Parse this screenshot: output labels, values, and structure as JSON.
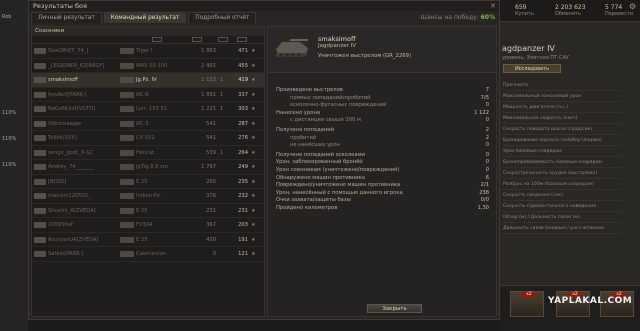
{
  "window": {
    "title": "Результаты боя"
  },
  "tabs": [
    {
      "label": "Личный результат"
    },
    {
      "label": "Командный результат"
    },
    {
      "label": "Подробный отчёт"
    }
  ],
  "win_chance": {
    "label": "Шансы на победу:",
    "value": "60%"
  },
  "allies": {
    "title": "Союзники",
    "rows": [
      {
        "player": "Sow28tt[T_74_]",
        "tank": "Tiger I",
        "xp": "1 863",
        "kills": "",
        "damage": "471",
        "dead": true
      },
      {
        "player": "_LEGIONER_62[BAGY]",
        "tank": "AMX 50 100",
        "xp": "2 401",
        "kills": "",
        "damage": "455",
        "dead": true
      },
      {
        "player": "smaksimoff",
        "tank": "Jg.Pz. IV",
        "xp": "1 122",
        "kills": "1",
        "damage": "419",
        "dead": false,
        "me": true
      },
      {
        "player": "fyrufert[PARK-]",
        "tank": "ИС-6",
        "xp": "1 891",
        "kills": "1",
        "damage": "337",
        "dead": true
      },
      {
        "player": "NaGaNUnit[VGTO]",
        "tank": "Lorr. 155 51",
        "xp": "1 215",
        "kills": "1",
        "damage": "303",
        "dead": true
      },
      {
        "player": "Vibromaager",
        "tank": "ИС-3",
        "xp": "541",
        "kills": "",
        "damage": "287",
        "dead": true
      },
      {
        "player": "Tolikk[SVX]",
        "tank": "СУ-152",
        "xp": "541",
        "kills": "",
        "damage": "276",
        "dead": true
      },
      {
        "player": "sengir_god[_X-G]",
        "tank": "Hellcat",
        "xp": "539",
        "kills": "1",
        "damage": "264",
        "dead": true
      },
      {
        "player": "Andrey_74_______",
        "tank": "JgTig.8,8 cm",
        "xp": "1 797",
        "kills": "",
        "damage": "249",
        "dead": true
      },
      {
        "player": "[BOSS]",
        "tank": "E 25",
        "xp": "265",
        "kills": "",
        "damage": "235",
        "dead": true
      },
      {
        "player": "maksim120502_",
        "tank": "Indien-Pz.",
        "xp": "376",
        "kills": "",
        "damage": "232",
        "dead": true
      },
      {
        "player": "Shustrij_A[ZVEDA]",
        "tank": "E 25",
        "xp": "231",
        "kills": "",
        "damage": "231",
        "dead": true
      },
      {
        "player": "2009Shef",
        "tank": "FV304",
        "xp": "367",
        "kills": "",
        "damage": "203",
        "dead": true
      },
      {
        "player": "AsuryanUA[ZVEDA]",
        "tank": "E 25",
        "xp": "420",
        "kills": "",
        "damage": "191",
        "dead": true
      },
      {
        "player": "Satkin[PARK-]",
        "tank": "Caernarvon",
        "xp": "0",
        "kills": "",
        "damage": "121",
        "dead": true
      }
    ]
  },
  "details": {
    "player": "smaksimoff",
    "tank": "Jagdpanzer IV",
    "killed_by": "Уничтожен выстрелом (GR_2269)",
    "stats": [
      {
        "label": "Произведено выстрелов",
        "value": "7",
        "sub": false
      },
      {
        "label": "прямых попаданий/пробитий",
        "value": "7/5",
        "sub": true
      },
      {
        "label": "осколочно-фугасных повреждений",
        "value": "0",
        "sub": true
      },
      {
        "label": "Нанесено урона",
        "value": "1 122",
        "sub": false
      },
      {
        "label": "с дистанции свыше 300 м",
        "value": "0",
        "sub": true
      },
      {
        "label": "Получено попаданий",
        "value": "2",
        "sub": false
      },
      {
        "label": "пробитий",
        "value": "2",
        "sub": true
      },
      {
        "label": "не нанёсших урон",
        "value": "0",
        "sub": true
      },
      {
        "label": "Получено попаданий осколками",
        "value": "0",
        "sub": false
      },
      {
        "label": "Урон, заблокированный бронёй",
        "value": "0",
        "sub": false
      },
      {
        "label": "Урон союзникам (уничтожено/повреждений)",
        "value": "0",
        "sub": false
      },
      {
        "label": "Обнаружено машин противника",
        "value": "6",
        "sub": false
      },
      {
        "label": "Повреждено/уничтожено машин противника",
        "value": "2/1",
        "sub": false
      },
      {
        "label": "Урон, нанесённый с помощью данного игрока",
        "value": "238",
        "sub": false
      },
      {
        "label": "Очки захвата/защиты базы",
        "value": "0/0",
        "sub": false
      },
      {
        "label": "Пройдено километров",
        "value": "1,30",
        "sub": false
      }
    ],
    "close_label": "Закрыть"
  },
  "background": {
    "credits": "2 203 623",
    "credits_sub": "Обменять",
    "gold": "659",
    "gold_sub": "Купить",
    "free_xp": "5 774",
    "free_xp_sub": "Перевести",
    "tank_name": "agdpanzer IV",
    "tank_sub": "уровень, Элитная ПТ-САУ",
    "research_label": "Исследовать",
    "side_list": [
      "Прочность",
      "Максимальный наносимый урон",
      "Мощность двигателя (л.с.)",
      "Максимальная скорость (км/ч)",
      "Скорость поворота шасси (град/сек)",
      "Бронирование корпуса (лоб/борт/корма)",
      "Урон базовым снарядом",
      "Бронепробиваемость базовым снарядом",
      "Скорострельность орудия (выстр/мин)",
      "Разброс на 100м (базовым снарядом)",
      "Скорость сведения (сек)",
      "Скорость горизонтального наведения",
      "Обзор (м) / Дальность связи (м)",
      "Дальность связи базовым / рассчитанное"
    ],
    "left_labels": [
      "Rob",
      "110%",
      "110%",
      "110%"
    ],
    "watermark": "YAPLAKAL.COM",
    "badge": "x2"
  },
  "colors": {
    "accent_green": "#8ab65a",
    "dialog_bg": "#272624",
    "badge_red": "#8b1c14"
  }
}
